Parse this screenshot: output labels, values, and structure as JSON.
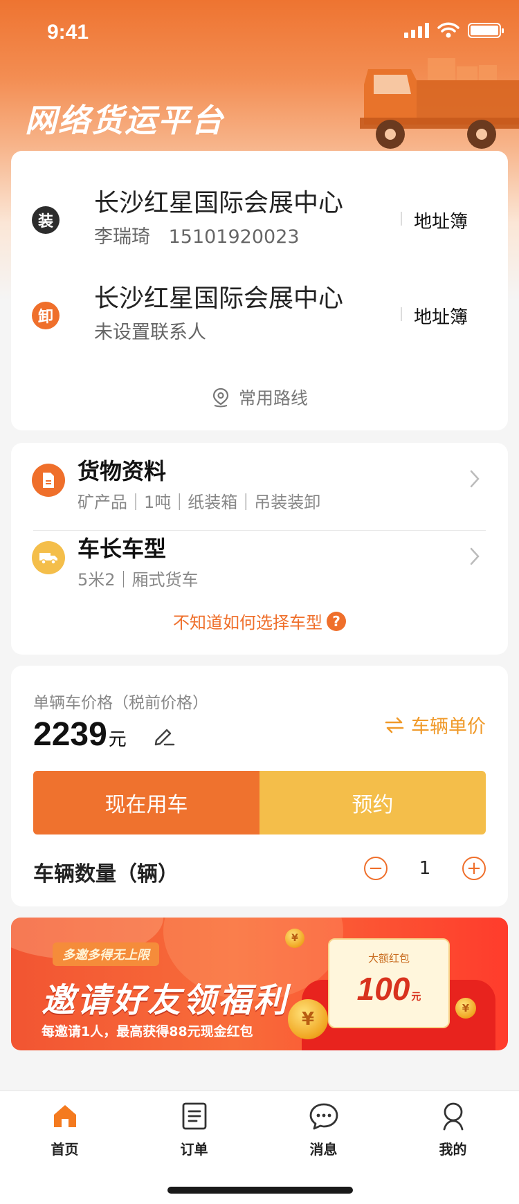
{
  "status_bar": {
    "time": "9:41"
  },
  "header": {
    "title": "网络货运平台"
  },
  "route": {
    "load": {
      "badge": "装",
      "place": "长沙红星国际会展中心",
      "contact_name": "李瑞琦",
      "contact_phone": "15101920023",
      "address_book": "地址簿"
    },
    "unload": {
      "badge": "卸",
      "place": "长沙红星国际会展中心",
      "contact": "未设置联系人",
      "address_book": "地址簿"
    },
    "common_routes": "常用路线"
  },
  "goods": {
    "title": "货物资料",
    "details": "矿产品｜1吨｜纸装箱｜吊装装卸"
  },
  "vehicle": {
    "title": "车长车型",
    "details": "5米2｜厢式货车",
    "help": "不知道如何选择车型",
    "help_icon": "?"
  },
  "price": {
    "label": "单辆车价格（税前价格）",
    "amount": "2239",
    "unit": "元",
    "unit_price_link": "车辆单价",
    "now_button": "现在用车",
    "book_button": "预约",
    "quantity_label": "车辆数量（辆）",
    "quantity": "1",
    "minus": "−",
    "plus": "+"
  },
  "banner": {
    "tag": "多邀多得无上限",
    "title": "邀请好友领福利",
    "subtitle": "每邀请1人，最高获得88元现金红包",
    "packet_label": "大额红包",
    "packet_amount": "100",
    "packet_unit": "元",
    "coin_symbol": "¥"
  },
  "tabs": [
    {
      "label": "首页",
      "icon": "home-icon",
      "active": true
    },
    {
      "label": "订单",
      "icon": "orders-icon",
      "active": false
    },
    {
      "label": "消息",
      "icon": "message-icon",
      "active": false
    },
    {
      "label": "我的",
      "icon": "profile-icon",
      "active": false
    }
  ],
  "colors": {
    "brand_orange": "#ef722e",
    "accent_yellow": "#f4be4a",
    "link_gold": "#f09a2a"
  }
}
